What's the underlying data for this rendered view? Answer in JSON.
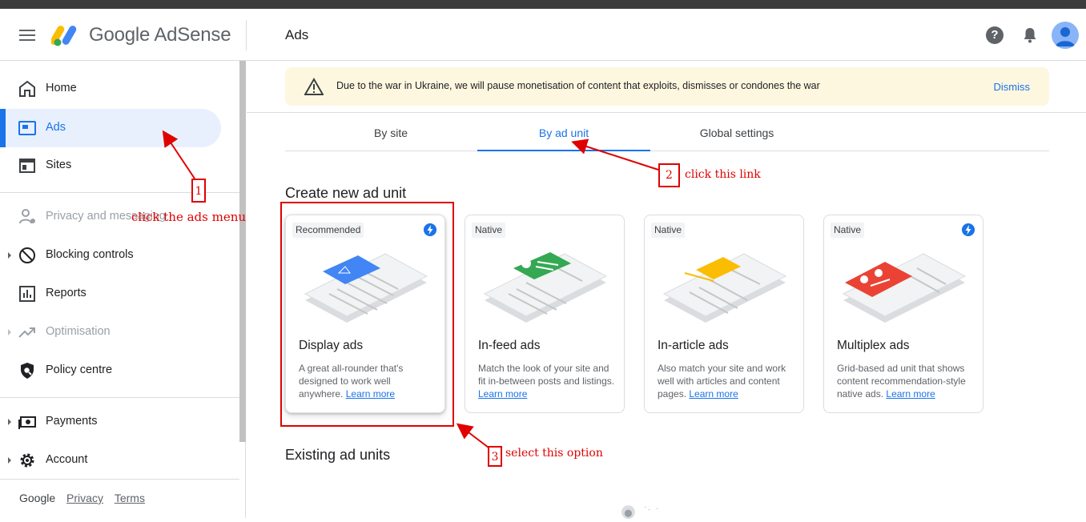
{
  "header": {
    "brand": "Google AdSense",
    "page_title": "Ads",
    "help_label": "?"
  },
  "sidebar": {
    "items": [
      {
        "label": "Home",
        "icon": "home-icon"
      },
      {
        "label": "Ads",
        "icon": "ads-icon"
      },
      {
        "label": "Sites",
        "icon": "sites-icon"
      },
      {
        "label": "Privacy and messaging",
        "icon": "privacy-icon"
      },
      {
        "label": "Blocking controls",
        "icon": "block-icon"
      },
      {
        "label": "Reports",
        "icon": "reports-icon"
      },
      {
        "label": "Optimisation",
        "icon": "trending-icon"
      },
      {
        "label": "Policy centre",
        "icon": "policy-icon"
      },
      {
        "label": "Payments",
        "icon": "payments-icon"
      },
      {
        "label": "Account",
        "icon": "gear-icon"
      }
    ],
    "footer": {
      "google": "Google",
      "privacy": "Privacy",
      "terms": "Terms"
    }
  },
  "banner": {
    "text": "Due to the war in Ukraine, we will pause monetisation of content that exploits, dismisses or condones the war",
    "dismiss": "Dismiss"
  },
  "tabs": [
    {
      "label": "By site"
    },
    {
      "label": "By ad unit"
    },
    {
      "label": "Global settings"
    }
  ],
  "create_title": "Create new ad unit",
  "existing_title": "Existing ad units",
  "cards": [
    {
      "chip": "Recommended",
      "title": "Display ads",
      "desc": "A great all-rounder that's designed to work well anywhere.",
      "link": "Learn more"
    },
    {
      "chip": "Native",
      "title": "In-feed ads",
      "desc": "Match the look of your site and fit in-between posts and listings.",
      "link": "Learn more"
    },
    {
      "chip": "Native",
      "title": "In-article ads",
      "desc": "Also match your site and work well with articles and content pages.",
      "link": "Learn more"
    },
    {
      "chip": "Native",
      "title": "Multiplex ads",
      "desc": "Grid-based ad unit that shows content recommendation-style native ads.",
      "link": "Learn more"
    }
  ],
  "annotations": {
    "n1": "1",
    "t1": "click the ads menu",
    "n2": "2",
    "t2": "click this link",
    "n3": "3",
    "t3": "select this option"
  },
  "colors": {
    "accent": "#1a73e8",
    "annotation": "#e00000",
    "banner_bg": "#fef7e0"
  }
}
